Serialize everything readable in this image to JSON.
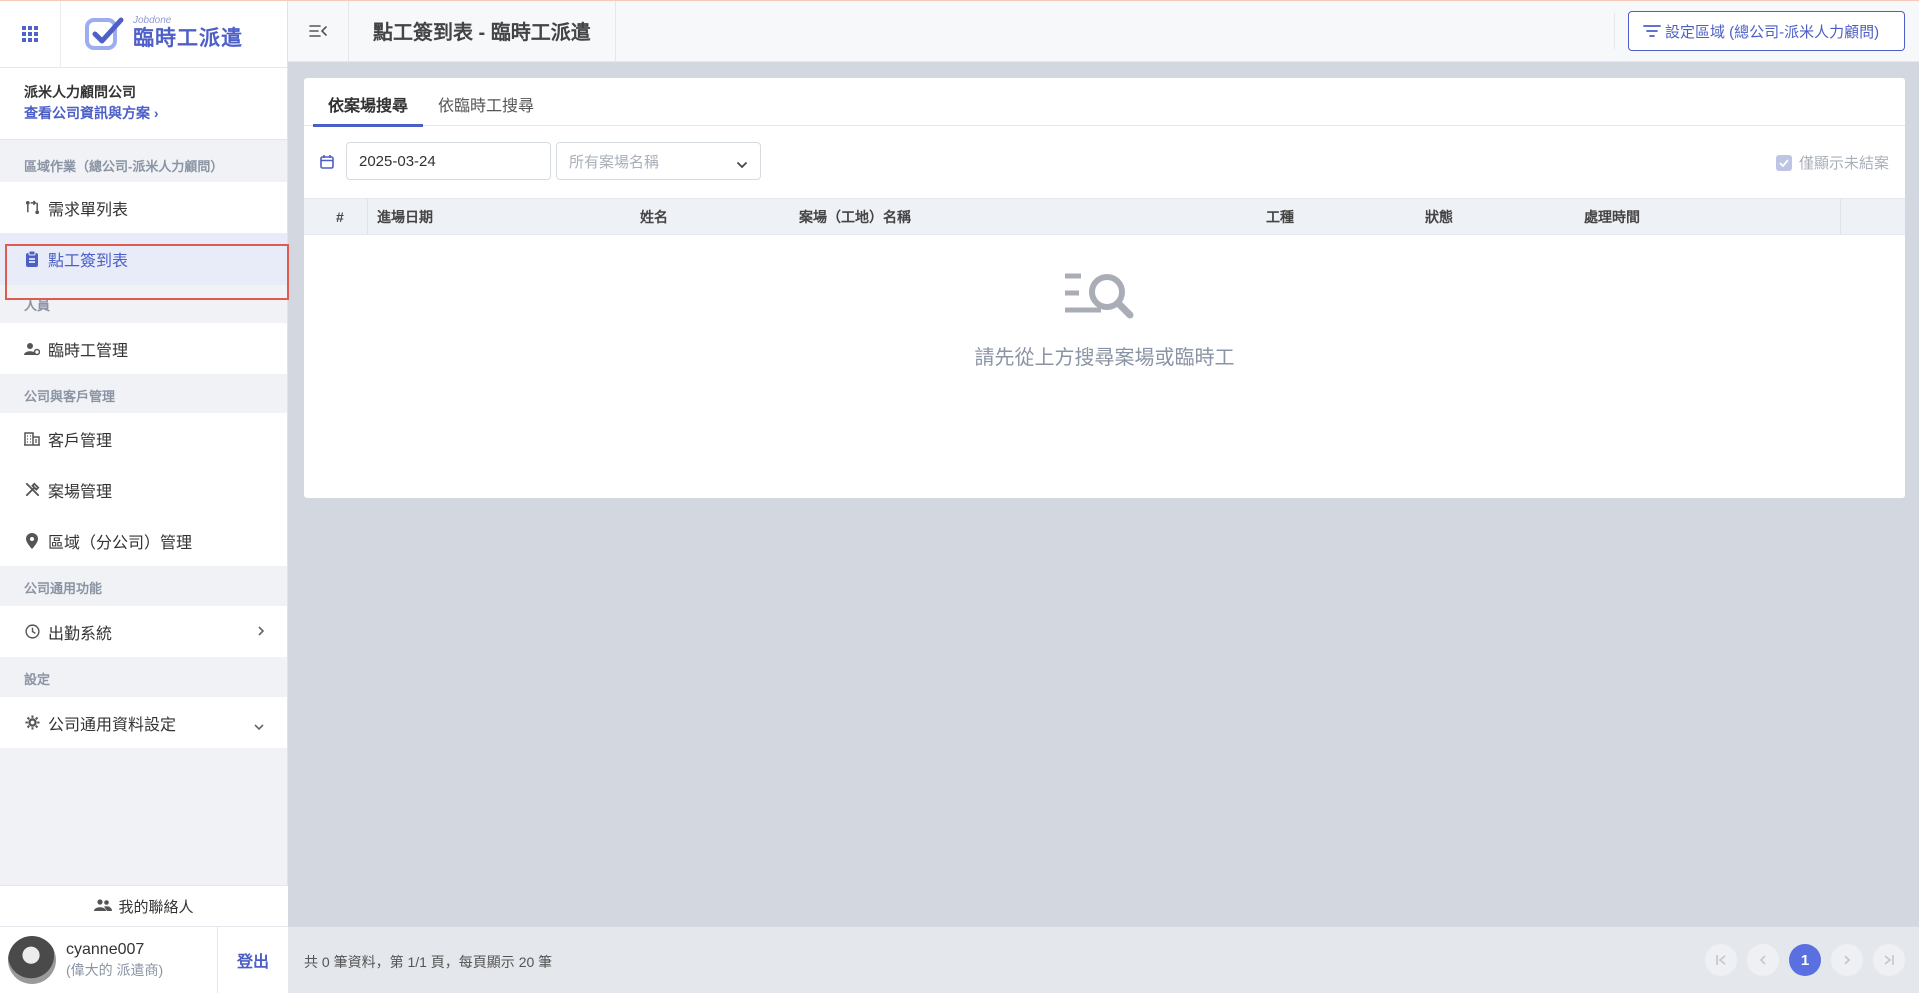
{
  "app": {
    "brand_small": "Jobdone",
    "brand_name": "臨時工派遣"
  },
  "company": {
    "name": "派米人力顧問公司",
    "link": "查看公司資訊與方案 ›"
  },
  "sidebar": {
    "sections": [
      {
        "label": "區域作業（總公司-派米人力顧問）",
        "items": [
          {
            "label": "需求單列表",
            "icon": "route-icon"
          },
          {
            "label": "點工簽到表",
            "icon": "clipboard-icon",
            "active": true
          }
        ]
      },
      {
        "label": "人員",
        "items": [
          {
            "label": "臨時工管理",
            "icon": "user-gear-icon"
          }
        ]
      },
      {
        "label": "公司與客戶管理",
        "items": [
          {
            "label": "客戶管理",
            "icon": "building-icon"
          },
          {
            "label": "案場管理",
            "icon": "tools-icon"
          },
          {
            "label": "區域（分公司）管理",
            "icon": "map-pin-icon"
          }
        ]
      },
      {
        "label": "公司通用功能",
        "items": [
          {
            "label": "出勤系統",
            "icon": "clock-icon"
          }
        ]
      },
      {
        "label": "設定",
        "items": [
          {
            "label": "公司通用資料設定",
            "icon": "gear-icon"
          }
        ]
      }
    ],
    "contacts_label": "我的聯絡人",
    "user": {
      "name": "cyanne007",
      "role": "(偉大的 派遣商)"
    },
    "logout_label": "登出"
  },
  "header": {
    "title": "點工簽到表 - 臨時工派遣",
    "region_button": "設定區域 (總公司-派米人力顧問)"
  },
  "tabs": [
    {
      "label": "依案場搜尋",
      "active": true
    },
    {
      "label": "依臨時工搜尋",
      "active": false
    }
  ],
  "filters": {
    "date": "2025-03-24",
    "site_placeholder": "所有案場名稱",
    "only_open_label": "僅顯示未結案",
    "only_open_checked": true
  },
  "table": {
    "columns": [
      "#",
      "進場日期",
      "姓名",
      "案場（工地）名稱",
      "工種",
      "狀態",
      "處理時間"
    ],
    "rows": []
  },
  "empty_state": {
    "message": "請先從上方搜尋案場或臨時工"
  },
  "footer": {
    "summary": "共 0 筆資料，第 1/1 頁，每頁顯示 20 筆",
    "current_page": "1"
  },
  "colors": {
    "accent": "#4c5fc7",
    "active_outline": "#df5b52",
    "page_bg": "#d3d8e0"
  }
}
